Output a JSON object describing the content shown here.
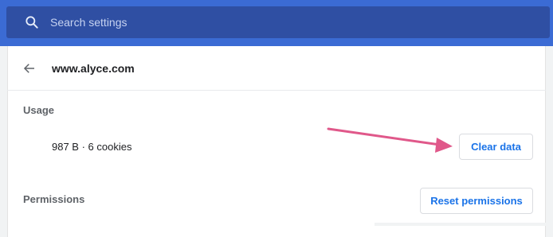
{
  "search": {
    "placeholder": "Search settings"
  },
  "header": {
    "site": "www.alyce.com"
  },
  "usage": {
    "label": "Usage",
    "summary": "987 B · 6 cookies",
    "clear_label": "Clear data"
  },
  "permissions": {
    "label": "Permissions",
    "reset_label": "Reset permissions"
  },
  "colors": {
    "topbar": "#3b6bd4",
    "searchbox": "#2f4fa3",
    "button_text": "#1a73e8",
    "annotation_arrow": "#e0588a"
  },
  "icons": {
    "search": "search-icon",
    "back": "back-arrow-icon",
    "annotation": "annotation-arrow"
  }
}
